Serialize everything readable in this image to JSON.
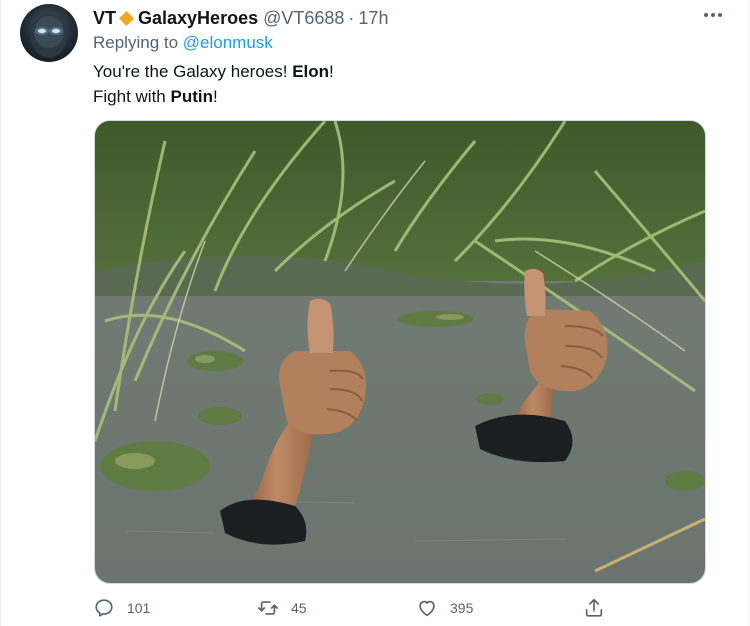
{
  "tweet": {
    "author_name_part1": "VT",
    "author_name_part2": "GalaxyHeroes",
    "handle": "@VT6688",
    "separator": "·",
    "time": "17h",
    "replying_prefix": "Replying to ",
    "replying_to": "@elonmusk",
    "line1_a": "You're the Galaxy heroes! ",
    "line1_b": "Elon",
    "line1_c": "!",
    "line2_a": "Fight with ",
    "line2_b": "Putin",
    "line2_c": "!",
    "more_icon": "more-horizontal-icon",
    "diamond_color": "#f5a623",
    "link_color": "#1d9bf0"
  },
  "actions": {
    "reply_count": "101",
    "retweet_count": "45",
    "like_count": "395"
  }
}
